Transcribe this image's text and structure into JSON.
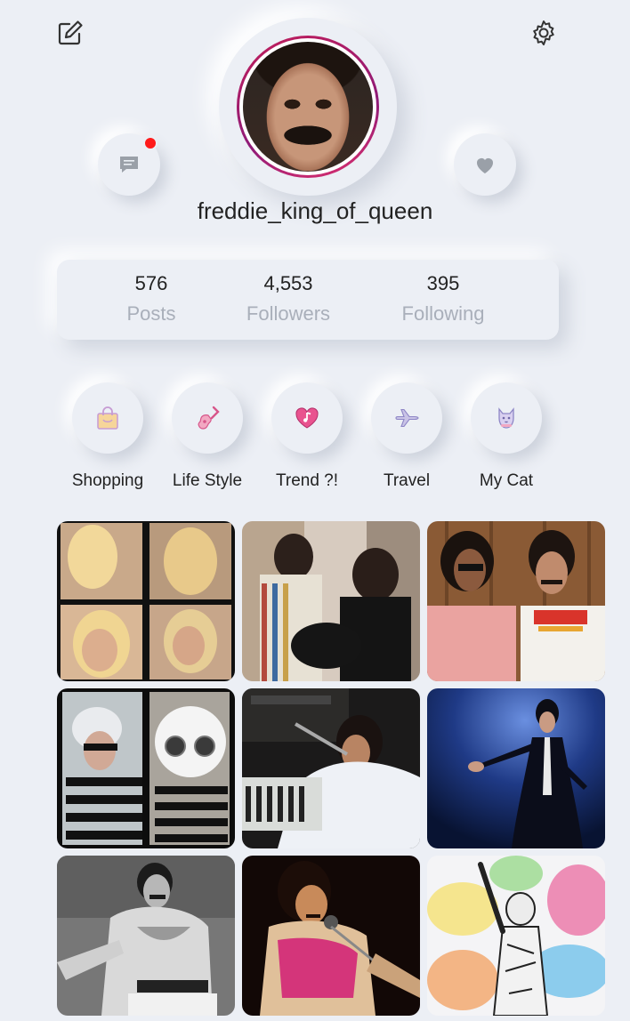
{
  "header": {
    "edit_icon": "edit-icon",
    "settings_icon": "gear-icon"
  },
  "profile": {
    "username": "freddie_king_of_queen",
    "has_unread_messages": true
  },
  "stats": {
    "posts": {
      "value": "576",
      "label": "Posts"
    },
    "followers": {
      "value": "4,553",
      "label": "Followers"
    },
    "following": {
      "value": "395",
      "label": "Following"
    }
  },
  "highlights": [
    {
      "label": "Shopping",
      "icon": "shopping-bag-icon"
    },
    {
      "label": "Life Style",
      "icon": "guitar-icon"
    },
    {
      "label": "Trend ?!",
      "icon": "heart-music-icon"
    },
    {
      "label": "Travel",
      "icon": "airplane-icon"
    },
    {
      "label": "My Cat",
      "icon": "cat-icon"
    }
  ],
  "colors": {
    "background": "#eceff5",
    "story_ring": "#c21e5a",
    "notification": "#ff1a1a",
    "muted_text": "#a9afba"
  }
}
